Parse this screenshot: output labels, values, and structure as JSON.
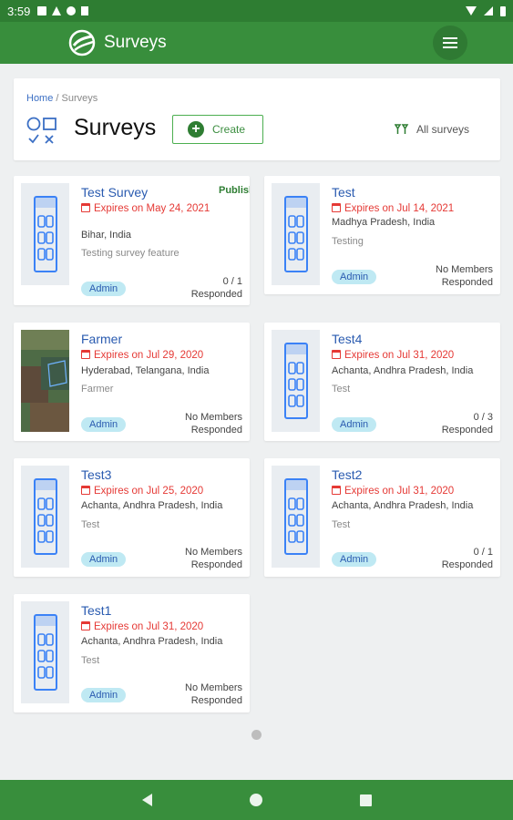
{
  "status_bar": {
    "time": "3:59"
  },
  "app_bar": {
    "title": "Surveys"
  },
  "header": {
    "breadcrumb_home": "Home",
    "breadcrumb_sep": " / ",
    "breadcrumb_current": "Surveys",
    "title": "Surveys",
    "create_label": "Create",
    "filter_label": "All surveys"
  },
  "surveys": [
    {
      "title": "Test Survey",
      "status": "Published",
      "expiry": "Expires on May 24, 2021",
      "location": "Bihar, India",
      "description": "Testing survey feature",
      "role": "Admin",
      "responded_count": "0 / 1",
      "responded_label": "Responded"
    },
    {
      "title": "Test",
      "expiry": "Expires on Jul 14, 2021",
      "location": "Madhya Pradesh, India",
      "description": "Testing",
      "role": "Admin",
      "responded_count": "No Members",
      "responded_label": "Responded"
    },
    {
      "title": "Farmer",
      "expiry": "Expires on Jul 29, 2020",
      "location": "Hyderabad, Telangana, India",
      "description": "Farmer",
      "role": "Admin",
      "responded_count": "No Members",
      "responded_label": "Responded"
    },
    {
      "title": "Test4",
      "expiry": "Expires on Jul 31, 2020",
      "location": "Achanta, Andhra Pradesh, India",
      "description": "Test",
      "role": "Admin",
      "responded_count": "0 / 3",
      "responded_label": "Responded"
    },
    {
      "title": "Test3",
      "expiry": "Expires on Jul 25, 2020",
      "location": "Achanta, Andhra Pradesh, India",
      "description": "Test",
      "role": "Admin",
      "responded_count": "No Members",
      "responded_label": "Responded"
    },
    {
      "title": "Test2",
      "expiry": "Expires on Jul 31, 2020",
      "location": "Achanta, Andhra Pradesh, India",
      "description": "Test",
      "role": "Admin",
      "responded_count": "0 / 1",
      "responded_label": "Responded"
    },
    {
      "title": "Test1",
      "expiry": "Expires on Jul 31, 2020",
      "location": "Achanta, Andhra Pradesh, India",
      "description": "Test",
      "role": "Admin",
      "responded_count": "No Members",
      "responded_label": "Responded"
    }
  ],
  "colors": {
    "brand_green": "#388e3c",
    "link_blue": "#2a5bb0",
    "expiry_red": "#e53935",
    "badge_bg": "#bfe9f3"
  }
}
